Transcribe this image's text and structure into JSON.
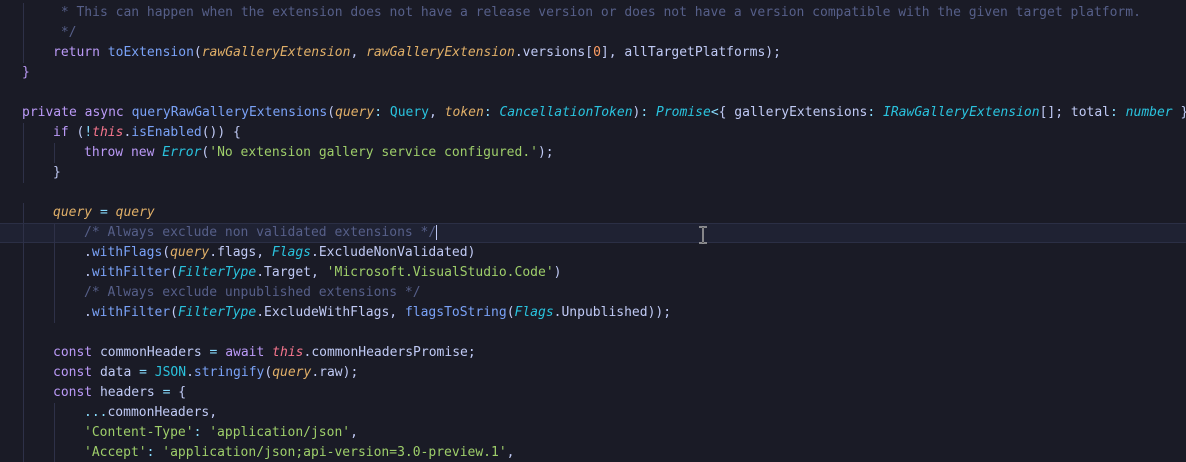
{
  "editor": {
    "lines": [
      {
        "indent": 1,
        "tokens": [
          {
            "c": "comment",
            "t": " * This can happen when the extension does not have a release version or does not have a version compatible with the given target platform."
          }
        ]
      },
      {
        "indent": 1,
        "tokens": [
          {
            "c": "comment",
            "t": " */"
          }
        ]
      },
      {
        "indent": 1,
        "tokens": [
          {
            "c": "keyword",
            "t": "return "
          },
          {
            "c": "func",
            "t": "toExtension"
          },
          {
            "c": "punct",
            "t": "("
          },
          {
            "c": "param",
            "t": "rawGalleryExtension"
          },
          {
            "c": "punct",
            "t": ", "
          },
          {
            "c": "param",
            "t": "rawGalleryExtension"
          },
          {
            "c": "punct",
            "t": "."
          },
          {
            "c": "prop",
            "t": "versions"
          },
          {
            "c": "punct",
            "t": "["
          },
          {
            "c": "number",
            "t": "0"
          },
          {
            "c": "punct",
            "t": "], "
          },
          {
            "c": "prop",
            "t": "allTargetPlatforms"
          },
          {
            "c": "punct",
            "t": ");"
          }
        ]
      },
      {
        "indent": 0,
        "tokens": [
          {
            "c": "keyword",
            "t": "}"
          }
        ]
      },
      {
        "indent": 0,
        "tokens": []
      },
      {
        "indent": 0,
        "tokens": [
          {
            "c": "keyword",
            "t": "private async "
          },
          {
            "c": "func",
            "t": "queryRawGalleryExtensions"
          },
          {
            "c": "punct",
            "t": "("
          },
          {
            "c": "param",
            "t": "query"
          },
          {
            "c": "op",
            "t": ": "
          },
          {
            "c": "type-plain",
            "t": "Query"
          },
          {
            "c": "punct",
            "t": ", "
          },
          {
            "c": "param",
            "t": "token"
          },
          {
            "c": "op",
            "t": ": "
          },
          {
            "c": "type",
            "t": "CancellationToken"
          },
          {
            "c": "punct",
            "t": ")"
          },
          {
            "c": "op",
            "t": ": "
          },
          {
            "c": "type",
            "t": "Promise"
          },
          {
            "c": "op",
            "t": "<"
          },
          {
            "c": "punct",
            "t": "{ "
          },
          {
            "c": "prop",
            "t": "galleryExtensions"
          },
          {
            "c": "op",
            "t": ": "
          },
          {
            "c": "type",
            "t": "IRawGalleryExtension"
          },
          {
            "c": "punct",
            "t": "[]; "
          },
          {
            "c": "prop",
            "t": "total"
          },
          {
            "c": "op",
            "t": ": "
          },
          {
            "c": "type",
            "t": "number"
          },
          {
            "c": "punct",
            "t": " }"
          },
          {
            "c": "op",
            "t": "> "
          },
          {
            "c": "brace-open",
            "t": "{"
          }
        ]
      },
      {
        "indent": 1,
        "tokens": [
          {
            "c": "keyword",
            "t": "if "
          },
          {
            "c": "punct",
            "t": "("
          },
          {
            "c": "op",
            "t": "!"
          },
          {
            "c": "this",
            "t": "this"
          },
          {
            "c": "punct",
            "t": "."
          },
          {
            "c": "func",
            "t": "isEnabled"
          },
          {
            "c": "punct",
            "t": "()) {"
          }
        ]
      },
      {
        "indent": 2,
        "tokens": [
          {
            "c": "keyword",
            "t": "throw new "
          },
          {
            "c": "type",
            "t": "Error"
          },
          {
            "c": "punct",
            "t": "("
          },
          {
            "c": "string",
            "t": "'No extension gallery service configured.'"
          },
          {
            "c": "punct",
            "t": ");"
          }
        ]
      },
      {
        "indent": 1,
        "tokens": [
          {
            "c": "punct",
            "t": "}"
          }
        ]
      },
      {
        "indent": 0,
        "tokens": []
      },
      {
        "indent": 1,
        "tokens": [
          {
            "c": "param",
            "t": "query"
          },
          {
            "c": "op",
            "t": " = "
          },
          {
            "c": "param",
            "t": "query"
          }
        ]
      },
      {
        "indent": 2,
        "current": true,
        "caret": true,
        "tokens": [
          {
            "c": "comment",
            "t": "/* Always exclude non validated extensions */"
          }
        ]
      },
      {
        "indent": 2,
        "tokens": [
          {
            "c": "punct",
            "t": "."
          },
          {
            "c": "func",
            "t": "withFlags"
          },
          {
            "c": "punct",
            "t": "("
          },
          {
            "c": "param",
            "t": "query"
          },
          {
            "c": "punct",
            "t": "."
          },
          {
            "c": "prop",
            "t": "flags"
          },
          {
            "c": "punct",
            "t": ", "
          },
          {
            "c": "type",
            "t": "Flags"
          },
          {
            "c": "punct",
            "t": "."
          },
          {
            "c": "prop",
            "t": "ExcludeNonValidated"
          },
          {
            "c": "punct",
            "t": ")"
          }
        ]
      },
      {
        "indent": 2,
        "tokens": [
          {
            "c": "punct",
            "t": "."
          },
          {
            "c": "func",
            "t": "withFilter"
          },
          {
            "c": "punct",
            "t": "("
          },
          {
            "c": "type",
            "t": "FilterType"
          },
          {
            "c": "punct",
            "t": "."
          },
          {
            "c": "prop",
            "t": "Target"
          },
          {
            "c": "punct",
            "t": ", "
          },
          {
            "c": "string",
            "t": "'Microsoft.VisualStudio.Code'"
          },
          {
            "c": "punct",
            "t": ")"
          }
        ]
      },
      {
        "indent": 2,
        "tokens": [
          {
            "c": "comment",
            "t": "/* Always exclude unpublished extensions */"
          }
        ]
      },
      {
        "indent": 2,
        "tokens": [
          {
            "c": "punct",
            "t": "."
          },
          {
            "c": "func",
            "t": "withFilter"
          },
          {
            "c": "punct",
            "t": "("
          },
          {
            "c": "type",
            "t": "FilterType"
          },
          {
            "c": "punct",
            "t": "."
          },
          {
            "c": "prop",
            "t": "ExcludeWithFlags"
          },
          {
            "c": "punct",
            "t": ", "
          },
          {
            "c": "func",
            "t": "flagsToString"
          },
          {
            "c": "punct",
            "t": "("
          },
          {
            "c": "type",
            "t": "Flags"
          },
          {
            "c": "punct",
            "t": "."
          },
          {
            "c": "prop",
            "t": "Unpublished"
          },
          {
            "c": "punct",
            "t": "));"
          }
        ]
      },
      {
        "indent": 1,
        "tokens": []
      },
      {
        "indent": 1,
        "tokens": [
          {
            "c": "keyword",
            "t": "const "
          },
          {
            "c": "prop",
            "t": "commonHeaders"
          },
          {
            "c": "op",
            "t": " = "
          },
          {
            "c": "keyword",
            "t": "await "
          },
          {
            "c": "this",
            "t": "this"
          },
          {
            "c": "punct",
            "t": "."
          },
          {
            "c": "prop",
            "t": "commonHeadersPromise"
          },
          {
            "c": "punct",
            "t": ";"
          }
        ]
      },
      {
        "indent": 1,
        "tokens": [
          {
            "c": "keyword",
            "t": "const "
          },
          {
            "c": "prop",
            "t": "data"
          },
          {
            "c": "op",
            "t": " = "
          },
          {
            "c": "type-plain",
            "t": "JSON"
          },
          {
            "c": "punct",
            "t": "."
          },
          {
            "c": "func",
            "t": "stringify"
          },
          {
            "c": "punct",
            "t": "("
          },
          {
            "c": "param",
            "t": "query"
          },
          {
            "c": "punct",
            "t": "."
          },
          {
            "c": "prop",
            "t": "raw"
          },
          {
            "c": "punct",
            "t": ");"
          }
        ]
      },
      {
        "indent": 1,
        "tokens": [
          {
            "c": "keyword",
            "t": "const "
          },
          {
            "c": "prop",
            "t": "headers"
          },
          {
            "c": "op",
            "t": " = "
          },
          {
            "c": "punct",
            "t": "{"
          }
        ]
      },
      {
        "indent": 2,
        "tokens": [
          {
            "c": "op",
            "t": "..."
          },
          {
            "c": "prop",
            "t": "commonHeaders"
          },
          {
            "c": "punct",
            "t": ","
          }
        ]
      },
      {
        "indent": 2,
        "tokens": [
          {
            "c": "string",
            "t": "'Content-Type'"
          },
          {
            "c": "op",
            "t": ": "
          },
          {
            "c": "string",
            "t": "'application/json'"
          },
          {
            "c": "punct",
            "t": ","
          }
        ]
      },
      {
        "indent": 2,
        "tokens": [
          {
            "c": "string",
            "t": "'Accept'"
          },
          {
            "c": "op",
            "t": ": "
          },
          {
            "c": "string",
            "t": "'application/json;api-version=3.0-preview.1'"
          },
          {
            "c": "punct",
            "t": ","
          }
        ]
      }
    ],
    "mouse_cursor_icon": "text-ibeam-cursor-icon"
  }
}
